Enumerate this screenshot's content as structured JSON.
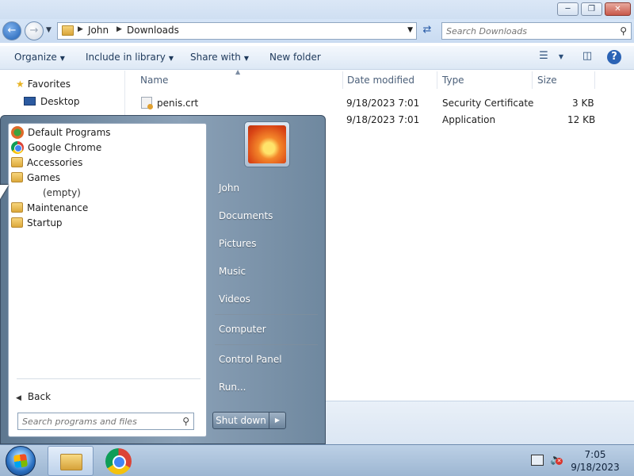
{
  "explorer": {
    "breadcrumb": [
      "John",
      "Downloads"
    ],
    "search_placeholder": "Search Downloads",
    "toolbar": {
      "organize": "Organize",
      "include_in_library": "Include in library",
      "share_with": "Share with",
      "new_folder": "New folder"
    },
    "nav": {
      "favorites": "Favorites",
      "desktop": "Desktop"
    },
    "columns": {
      "name": "Name",
      "date_modified": "Date modified",
      "type": "Type",
      "size": "Size"
    },
    "files": [
      {
        "name": "penis.crt",
        "date": "9/18/2023 7:01",
        "type": "Security Certificate",
        "size": "3 KB"
      },
      {
        "name": "",
        "date": "9/18/2023 7:01",
        "type": "Application",
        "size": "12 KB"
      }
    ]
  },
  "start_menu": {
    "programs": [
      {
        "label": "Default Programs",
        "icon": "default-programs-icon"
      },
      {
        "label": "Google Chrome",
        "icon": "chrome-icon"
      },
      {
        "label": "Accessories",
        "icon": "folder-icon"
      },
      {
        "label": "Games",
        "icon": "folder-icon"
      },
      {
        "label": "(empty)",
        "icon": ""
      },
      {
        "label": "Maintenance",
        "icon": "folder-icon"
      },
      {
        "label": "Startup",
        "icon": "folder-icon"
      }
    ],
    "back": "Back",
    "search_placeholder": "Search programs and files",
    "right_links": [
      "John",
      "Documents",
      "Pictures",
      "Music",
      "Videos",
      "Computer",
      "Control Panel",
      "Run..."
    ],
    "shutdown": "Shut down"
  },
  "taskbar": {
    "time": "7:05",
    "date": "9/18/2023"
  },
  "colors": {
    "start_menu_accent": "#6f889f",
    "titlebar": "#cfdff2",
    "column_header_text": "#4c607a"
  }
}
